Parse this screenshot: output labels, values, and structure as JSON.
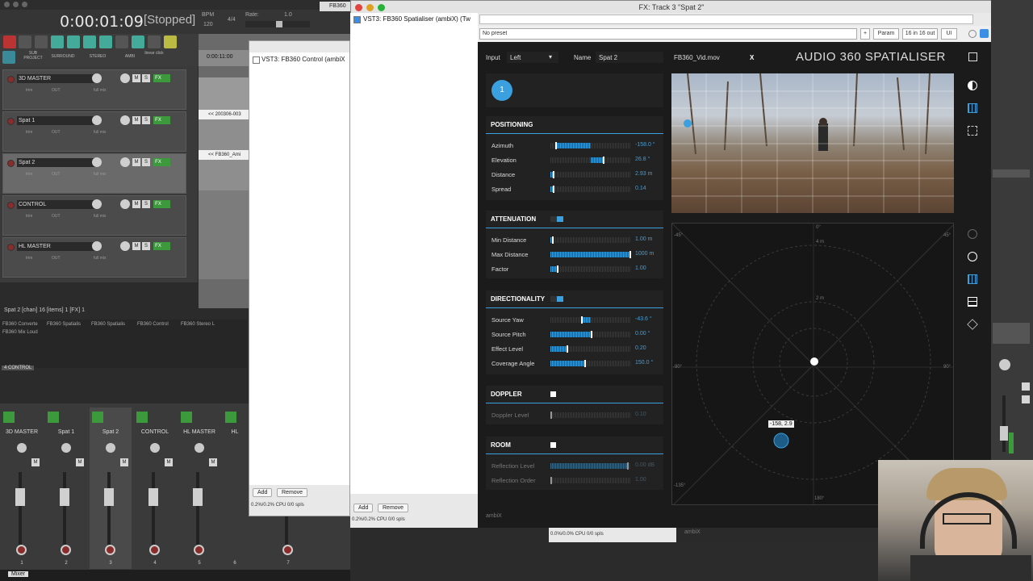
{
  "daw": {
    "time": "0:00:01:09",
    "state": "[Stopped]",
    "bpm_label": "BPM",
    "bpm": "120",
    "signature": "4/4",
    "rate_label": "Rate:",
    "rate": "1.0",
    "toolbar_labels": [
      "SUB PROJECT",
      "SURROUND",
      "STEREO",
      "AMBI",
      "linear click"
    ],
    "ruler_time": "0:00:11:00",
    "items": [
      "<< 200306-003",
      "<< FB360_Ami"
    ],
    "tracks": [
      {
        "name": "3D MASTER",
        "selected": false
      },
      {
        "name": "Spat 1",
        "selected": false
      },
      {
        "name": "Spat 2",
        "selected": true
      },
      {
        "name": "CONTROL",
        "selected": false
      },
      {
        "name": "HL MASTER",
        "selected": false
      }
    ],
    "track_buttons": {
      "m": "M",
      "s": "S",
      "fx": "FX",
      "trim": "trim",
      "out": "OUT",
      "mix": "full mix"
    },
    "status_line": "Spat 2 [chan] 16 [items] 1 [FX] 1",
    "fx_list": [
      "FB360 Converte",
      "FB360 Spatialis",
      "FB360 Spatialis",
      "FB360 Control",
      "FB360 Stereo L",
      "FB360 Mix Loud"
    ],
    "control_tag": "4 CONTROL",
    "mixer_strips": [
      "3D MASTER",
      "Spat 1",
      "Spat 2",
      "CONTROL",
      "HL MASTER",
      "HL"
    ],
    "mixer_numbers": [
      "1",
      "2",
      "3",
      "4",
      "5",
      "6",
      "7"
    ],
    "mixer_tab": "Mixer"
  },
  "control_window": {
    "title_partial": "FB360",
    "fx_item": "VST3: FB360 Control (ambiX",
    "add": "Add",
    "remove": "Remove",
    "cpu": "0.2%/0.2% CPU 0/0 spls"
  },
  "fx_window": {
    "title": "FX: Track 3 \"Spat 2\"",
    "fx_item": "VST3: FB360 Spatialiser (ambiX) (Tw",
    "preset": "No preset",
    "plus": "+",
    "param": "Param",
    "io": "16 in 16 out",
    "ui": "UI",
    "add": "Add",
    "remove": "Remove",
    "cpu": "0.2%/0.2% CPU 0/0 spls"
  },
  "plugin": {
    "input_label": "Input",
    "input_value": "Left",
    "name_label": "Name",
    "name_value": "Spat 2",
    "video_file": "FB360_Vid.mov",
    "close": "X",
    "brand": "AUDIO 360 SPATIALISER",
    "source_number": "1",
    "format": "ambiX",
    "positioning": {
      "title": "POSITIONING",
      "params": [
        {
          "label": "Azimuth",
          "value": "-158.0 °",
          "fill": 0.06,
          "thumb": 0.06,
          "bar_to": 0.5
        },
        {
          "label": "Elevation",
          "value": "26.8 °",
          "fill": 0.65,
          "thumb": 0.65,
          "bar_from": 0.5
        },
        {
          "label": "Distance",
          "value": "2.93 m",
          "fill": 0.03,
          "thumb": 0.03
        },
        {
          "label": "Spread",
          "value": "0.14",
          "fill": 0.03,
          "thumb": 0.03
        }
      ]
    },
    "attenuation": {
      "title": "ATTENUATION",
      "params": [
        {
          "label": "Min Distance",
          "value": "1.00 m",
          "fill": 0.02,
          "thumb": 0.02
        },
        {
          "label": "Max Distance",
          "value": "1000 m",
          "fill": 1.0,
          "thumb": 1.0
        },
        {
          "label": "Factor",
          "value": "1.00",
          "fill": 0.08,
          "thumb": 0.08
        }
      ]
    },
    "directionality": {
      "title": "DIRECTIONALITY",
      "params": [
        {
          "label": "Source Yaw",
          "value": "-43.6 °",
          "fill": 0.38,
          "thumb": 0.38,
          "bar_from": 0.38,
          "bar_to": 0.5
        },
        {
          "label": "Source Pitch",
          "value": "0.00 °",
          "fill": 0.5,
          "thumb": 0.5
        },
        {
          "label": "Effect Level",
          "value": "0.20",
          "fill": 0.2,
          "thumb": 0.2
        },
        {
          "label": "Coverage Angle",
          "value": "150.0 °",
          "fill": 0.42,
          "thumb": 0.42
        }
      ]
    },
    "doppler": {
      "title": "DOPPLER",
      "params": [
        {
          "label": "Doppler Level",
          "value": "0.10",
          "fill": 0.0,
          "thumb": 0.0
        }
      ]
    },
    "room": {
      "title": "ROOM",
      "params": [
        {
          "label": "Reflection Level",
          "value": "0.00 dB",
          "fill": 0.95,
          "thumb": 0.95
        },
        {
          "label": "Reflection Order",
          "value": "1.00",
          "fill": 0.0,
          "thumb": 0.0
        }
      ]
    },
    "radar": {
      "top": "0°",
      "bottom": "180°",
      "left": "-90°",
      "right": "90°",
      "tl": "-45°",
      "tr": "45°",
      "bl": "-135°",
      "ring_4m": "4 m",
      "ring_2m": "2 m",
      "tooltip": "-158, 2.9"
    },
    "colors": {
      "accent": "#3ba0e0",
      "bg": "#1b1b1b"
    }
  },
  "bottom_bar": {
    "cpu": "0.0%/0.0% CPU 0/0 spls",
    "format": "ambiX"
  }
}
